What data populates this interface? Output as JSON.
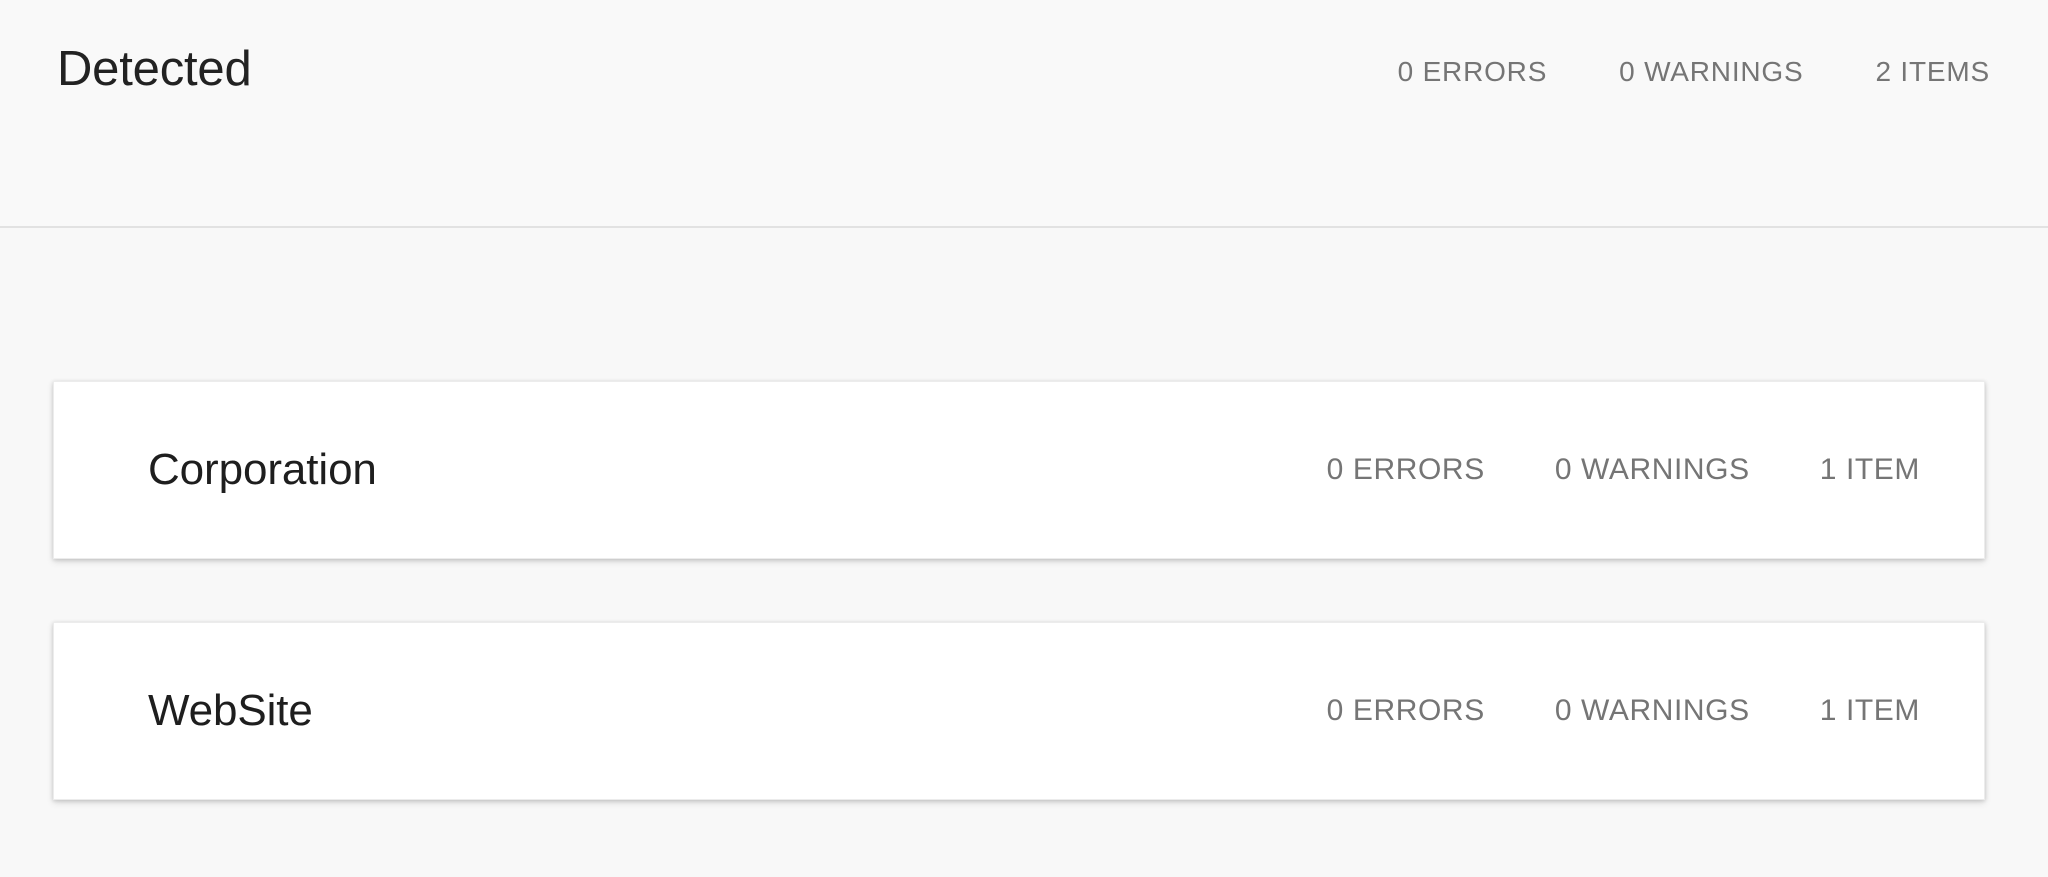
{
  "colors": {
    "page_background": "#f8f8f8",
    "header_background": "#f9f9f9",
    "divider": "#e2e2e2",
    "card_background": "#ffffff",
    "title_text": "#222222",
    "stat_text": "#757575"
  },
  "header": {
    "title": "Detected",
    "stats": [
      {
        "label": "0 ERRORS"
      },
      {
        "label": "0 WARNINGS"
      },
      {
        "label": "2 ITEMS"
      }
    ]
  },
  "cards": [
    {
      "label": "Corporation",
      "stats": [
        {
          "label": "0 ERRORS"
        },
        {
          "label": "0 WARNINGS"
        },
        {
          "label": "1 ITEM"
        }
      ]
    },
    {
      "label": "WebSite",
      "stats": [
        {
          "label": "0 ERRORS"
        },
        {
          "label": "0 WARNINGS"
        },
        {
          "label": "1 ITEM"
        }
      ]
    }
  ]
}
